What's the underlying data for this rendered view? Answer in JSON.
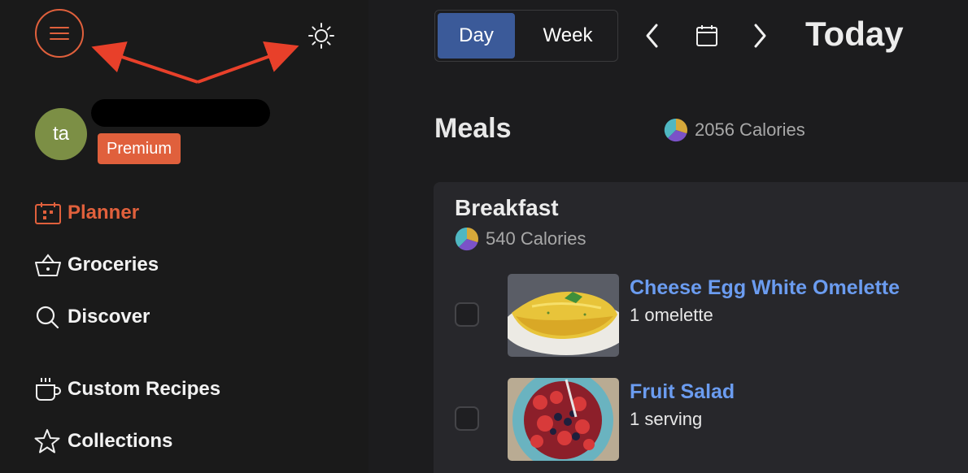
{
  "sidebar": {
    "user": {
      "initials": "ta",
      "badge": "Premium"
    },
    "nav": [
      {
        "label": "Planner",
        "icon": "calendar-icon",
        "active": true
      },
      {
        "label": "Groceries",
        "icon": "basket-icon"
      },
      {
        "label": "Discover",
        "icon": "search-icon"
      },
      {
        "label": "Custom Recipes",
        "icon": "mug-icon"
      },
      {
        "label": "Collections",
        "icon": "star-icon"
      }
    ]
  },
  "header": {
    "view_toggle": {
      "day": "Day",
      "week": "Week",
      "selected": "Day"
    },
    "title": "Today"
  },
  "meals": {
    "title": "Meals",
    "total_calories": "2056 Calories",
    "sections": [
      {
        "title": "Breakfast",
        "calories": "540 Calories",
        "items": [
          {
            "name": "Cheese Egg White Omelette",
            "serving": "1 omelette",
            "checked": false
          },
          {
            "name": "Fruit Salad",
            "serving": "1 serving",
            "checked": false
          }
        ]
      }
    ]
  },
  "colors": {
    "accent": "#e0603c",
    "selected_tab": "#3b5a99",
    "link": "#6b9cf0",
    "avatar": "#7c8f45",
    "annotation_arrow": "#e8402a"
  }
}
